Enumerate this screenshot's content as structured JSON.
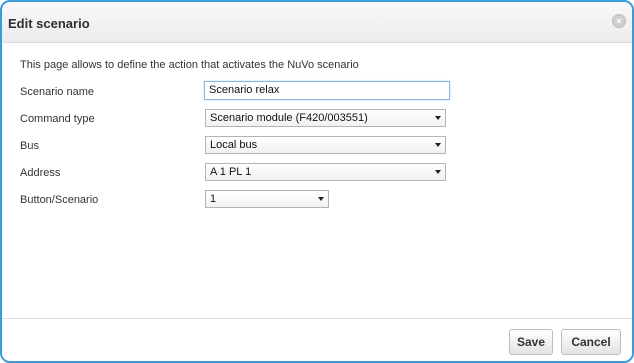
{
  "dialog": {
    "title": "Edit scenario",
    "close_icon": "close-icon",
    "accent_color": "#3a9bdc"
  },
  "intro_text": "This page allows to define the action that activates the NuVo scenario",
  "form": {
    "scenario_name": {
      "label": "Scenario name",
      "value": "Scenario relax"
    },
    "command_type": {
      "label": "Command type",
      "value": "Scenario module (F420/003551)"
    },
    "bus": {
      "label": "Bus",
      "value": "Local bus"
    },
    "address": {
      "label": "Address",
      "value": "A 1 PL 1"
    },
    "button_scenario": {
      "label": "Button/Scenario",
      "value": "1"
    }
  },
  "footer": {
    "save_label": "Save",
    "cancel_label": "Cancel"
  }
}
